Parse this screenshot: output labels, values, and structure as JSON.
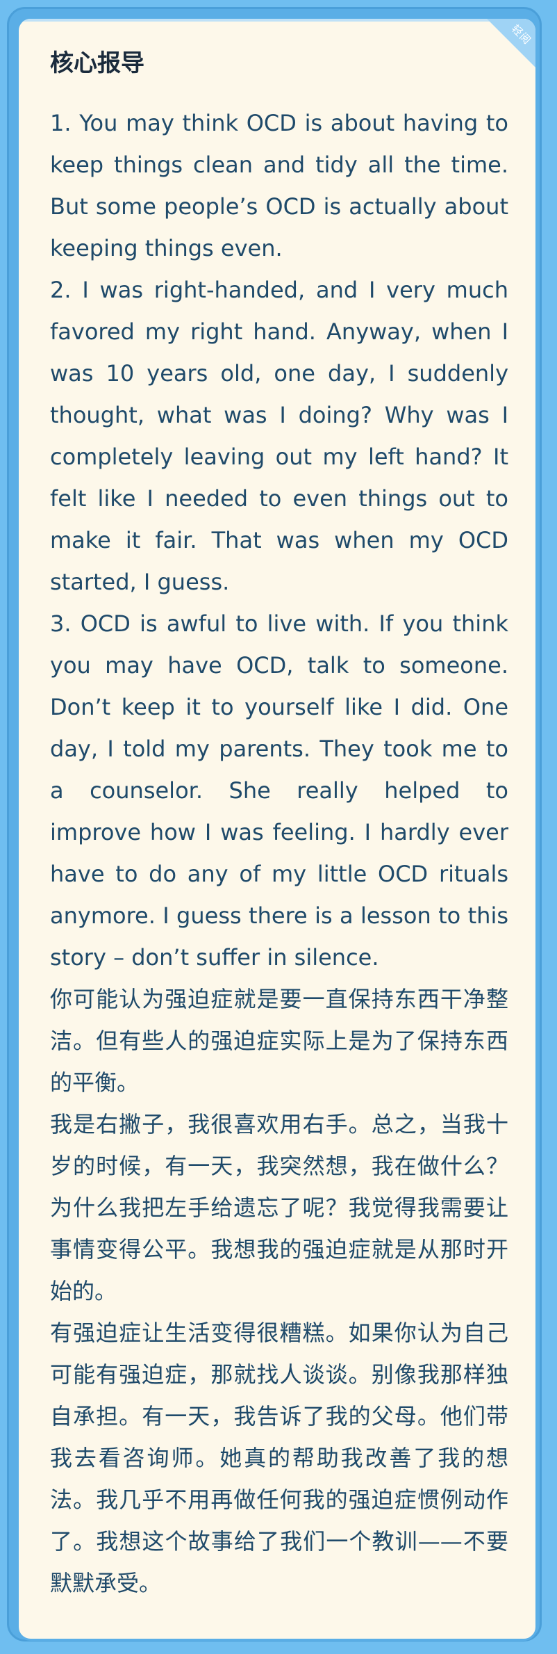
{
  "card": {
    "title": "核心报导",
    "corner_label": "轻阅"
  },
  "paragraphs": [
    "1. You may think OCD is about having to keep things clean and tidy all the time. But some people’s OCD is actually about keeping things even.",
    "2. I was right-handed, and I very much favored my right hand. Anyway, when I was 10 years old, one day, I suddenly thought, what was I doing? Why was I completely leaving out my left hand? It felt like I needed to even things out to make it fair. That was when my OCD started, I guess.",
    "3. OCD is awful to live with. If you think you may have OCD, talk to someone. Don’t keep it to yourself like I did. One day, I told my parents. They took me to a counselor. She really helped to improve how I was feeling. I hardly ever have to do any of my little OCD rituals anymore. I guess there is a lesson to this story – don’t suffer in silence.",
    "你可能认为强迫症就是要一直保持东西干净整洁。但有些人的强迫症实际上是为了保持东西的平衡。",
    "我是右撇子，我很喜欢用右手。总之，当我十岁的时候，有一天，我突然想，我在做什么？为什么我把左手给遗忘了呢？我觉得我需要让事情变得公平。我想我的强迫症就是从那时开始的。",
    "有强迫症让生活变得很糟糕。如果你认为自己可能有强迫症，那就找人谈谈。别像我那样独自承担。有一天，我告诉了我的父母。他们带我去看咨询师。她真的帮助我改善了我的想法。我几乎不用再做任何我的强迫症惯例动作了。我想这个故事给了我们一个教训——不要默默承受。"
  ]
}
